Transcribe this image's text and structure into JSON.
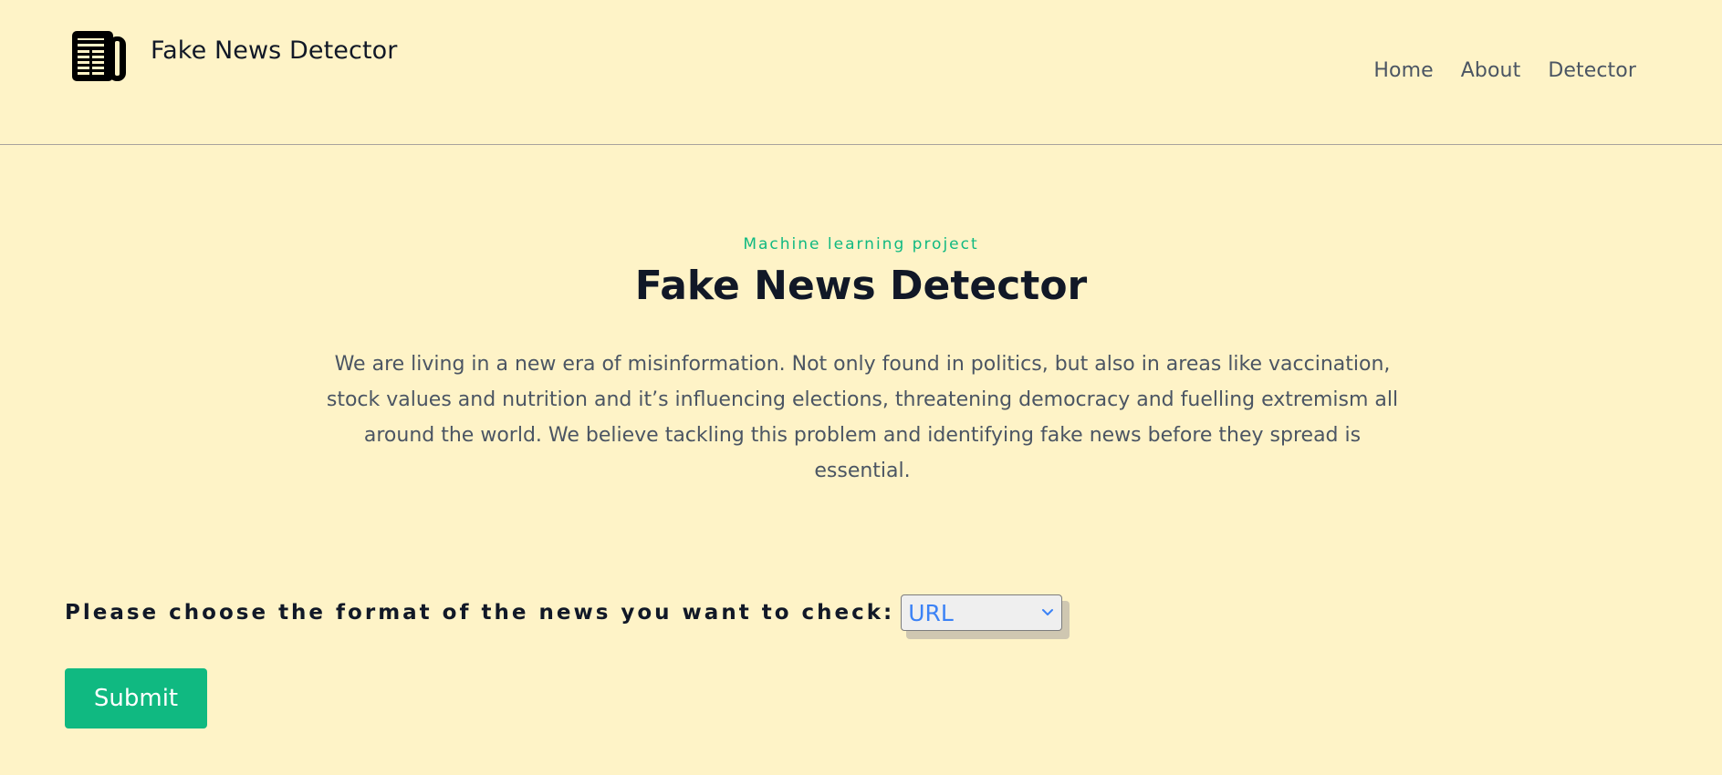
{
  "header": {
    "brand_name": "Fake News Detector",
    "brand_icon": "newspaper-icon",
    "nav": [
      "Home",
      "About",
      "Detector"
    ]
  },
  "hero": {
    "eyebrow": "Machine learning project",
    "title": "Fake News Detector",
    "description": "We are living in a new era of misinformation. Not only found in politics, but also in areas like vaccination, stock values and nutrition and it’s influencing elections, threatening democracy and fuelling extremism all around the world. We believe tackling this problem and identifying fake news before they spread is essential."
  },
  "form": {
    "label": "Please choose the format of the news you want to check:",
    "format_value": "URL",
    "submit_label": "Submit"
  },
  "colors": {
    "background": "#fef3c7",
    "accent": "#10b981",
    "text_primary": "#111827",
    "text_secondary": "#4b5563",
    "select_value": "#3b82f6"
  }
}
